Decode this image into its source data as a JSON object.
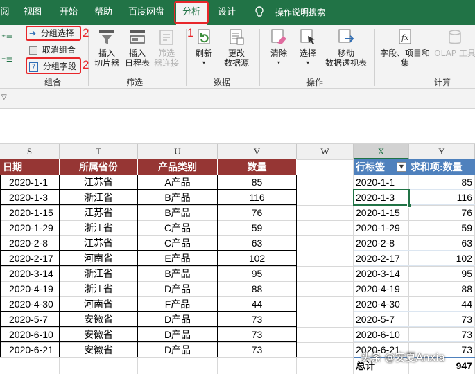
{
  "ribbon_tabs": [
    "阅",
    "视图",
    "开始",
    "帮助",
    "百度网盘",
    "分析",
    "设计"
  ],
  "active_tab": "分析",
  "tell_me": "操作说明搜索",
  "annotations": {
    "mark1": "1",
    "mark2a": "2",
    "mark2b": "2"
  },
  "group_section": {
    "select_group": "分组选择",
    "ungroup": "取消组合",
    "group_field": "分组字段",
    "label": "组合"
  },
  "filter_section": {
    "slicer": [
      "插入",
      "切片器"
    ],
    "timeline": [
      "插入",
      "日程表"
    ],
    "filter_conn": [
      "筛选",
      "器连接"
    ],
    "label": "筛选"
  },
  "data_section": {
    "refresh": "刷新",
    "change_source": [
      "更改",
      "数据源"
    ],
    "label": "数据"
  },
  "action_section": {
    "clear": "清除",
    "select": "选择",
    "move": [
      "移动",
      "数据透视表"
    ],
    "label": "操作"
  },
  "calc_section": {
    "fields": [
      "字段、项目和",
      "集"
    ],
    "olap": [
      "OLAP 工具"
    ],
    "label": "计算"
  },
  "columns": [
    "S",
    "T",
    "U",
    "V",
    "W",
    "X",
    "Y"
  ],
  "table": {
    "headers": [
      "日期",
      "所属省份",
      "产品类别",
      "数量"
    ],
    "rows": [
      [
        "2020-1-1",
        "江苏省",
        "A产品",
        "85"
      ],
      [
        "2020-1-3",
        "浙江省",
        "B产品",
        "116"
      ],
      [
        "2020-1-15",
        "江苏省",
        "B产品",
        "76"
      ],
      [
        "2020-1-29",
        "浙江省",
        "C产品",
        "59"
      ],
      [
        "2020-2-8",
        "江苏省",
        "C产品",
        "63"
      ],
      [
        "2020-2-17",
        "河南省",
        "E产品",
        "102"
      ],
      [
        "2020-3-14",
        "浙江省",
        "B产品",
        "95"
      ],
      [
        "2020-4-19",
        "浙江省",
        "D产品",
        "88"
      ],
      [
        "2020-4-30",
        "河南省",
        "F产品",
        "44"
      ],
      [
        "2020-5-7",
        "安徽省",
        "D产品",
        "73"
      ],
      [
        "2020-6-10",
        "安徽省",
        "D产品",
        "73"
      ],
      [
        "2020-6-21",
        "安徽省",
        "D产品",
        "73"
      ]
    ]
  },
  "pivot": {
    "row_label": "行标签",
    "value_label": "求和项:数量",
    "rows": [
      [
        "2020-1-1",
        "85"
      ],
      [
        "2020-1-3",
        "116"
      ],
      [
        "2020-1-15",
        "76"
      ],
      [
        "2020-1-29",
        "59"
      ],
      [
        "2020-2-8",
        "63"
      ],
      [
        "2020-2-17",
        "102"
      ],
      [
        "2020-3-14",
        "95"
      ],
      [
        "2020-4-19",
        "88"
      ],
      [
        "2020-4-30",
        "44"
      ],
      [
        "2020-5-7",
        "73"
      ],
      [
        "2020-6-10",
        "73"
      ],
      [
        "2020-6-21",
        "73"
      ]
    ],
    "total_label": "总计",
    "total_value": "947"
  },
  "watermark": "头条 @安夏Anxia",
  "colors": {
    "ribbon": "#217346",
    "table_header": "#963634",
    "pivot_header": "#4f81bd",
    "annotation": "#e8262a"
  }
}
